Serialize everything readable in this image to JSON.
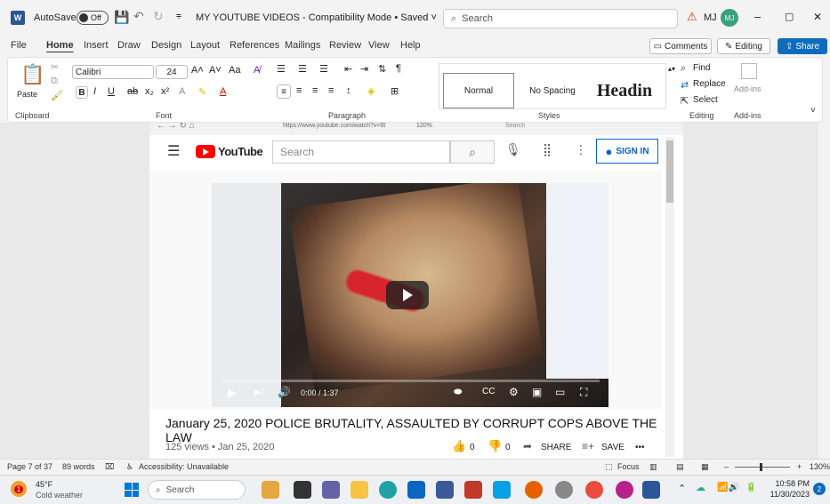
{
  "titlebar": {
    "autosave_label": "AutoSave",
    "autosave_state": "Off",
    "doc_title": "MY YOUTUBE VIDEOS - Compatibility Mode • Saved ˅",
    "search_placeholder": "Search",
    "user_initials": "MJ",
    "avatar_initials": "MJ",
    "min": "–",
    "max": "▢",
    "close": "✕"
  },
  "menu": {
    "items": [
      "File",
      "Home",
      "Insert",
      "Draw",
      "Design",
      "Layout",
      "References",
      "Mailings",
      "Review",
      "View",
      "Help"
    ],
    "comments": "Comments",
    "editing": "Editing",
    "share": "Share"
  },
  "ribbon": {
    "paste": "Paste",
    "font_name": "Calibri",
    "font_size": "24",
    "groups": {
      "clipboard": "Clipboard",
      "font": "Font",
      "paragraph": "Paragraph",
      "styles": "Styles",
      "editing": "Editing",
      "addins": "Add-ins"
    },
    "styles": [
      "Normal",
      "No Spacing",
      "Headin"
    ],
    "find": "Find",
    "replace": "Replace",
    "select": "Select",
    "addins_btn": "Add-ins"
  },
  "browser": {
    "url": "https://www.youtube.com/watch?v=9t",
    "zoom": "120%",
    "search_placeholder": "Search"
  },
  "youtube": {
    "logo_text": "YouTube",
    "search_placeholder": "Search",
    "sign_in": "SIGN IN",
    "time": "0:00 / 1:37",
    "title": "January 25, 2020 POLICE BRUTALITY, ASSAULTED BY CORRUPT COPS ABOVE THE LAW",
    "meta": "125 views • Jan 25, 2020",
    "likes": "0",
    "dislikes": "0",
    "share": "SHARE",
    "save": "SAVE",
    "more": "•••",
    "progress": 0
  },
  "statusbar": {
    "page": "Page 7 of 37",
    "words": "89 words",
    "accessibility": "Accessibility: Unavailable",
    "focus": "Focus",
    "zoom": "130%"
  },
  "taskbar": {
    "weather_temp": "45°F",
    "weather_desc": "Cold weather",
    "search_placeholder": "Search",
    "time": "10:58 PM",
    "date": "11/30/2023",
    "notif_count": "2",
    "weather_badge": "1"
  },
  "colors": {
    "word_blue": "#2b579a",
    "yt_red": "#ff0000",
    "yt_blue": "#065fd4",
    "share_blue": "#0f6cbd"
  }
}
